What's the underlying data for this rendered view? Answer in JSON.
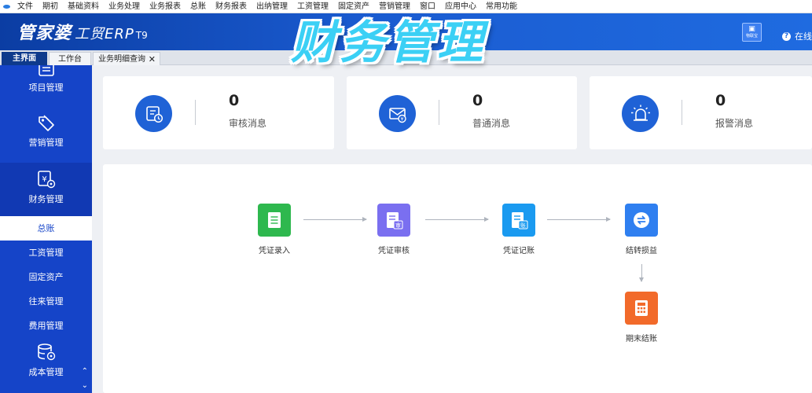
{
  "menubar": {
    "items": [
      "文件",
      "期初",
      "基础资料",
      "业务处理",
      "业务报表",
      "总账",
      "财务报表",
      "出纳管理",
      "工资管理",
      "固定资产",
      "营销管理",
      "窗口",
      "应用中心",
      "常用功能"
    ]
  },
  "header": {
    "logo_main": "管家婆",
    "logo_sub": "工贸ERP",
    "logo_version": "T9",
    "banner_title": "财务管理",
    "iot_label": "物联宝",
    "online_text": "在线"
  },
  "tabs": {
    "main": "主界面",
    "workbench": "工作台",
    "query": "业务明细查询",
    "close_glyph": "✕"
  },
  "sidebar": {
    "modules": {
      "project": "项目管理",
      "marketing": "营销管理",
      "finance": "财务管理",
      "cost": "成本管理"
    },
    "sub_items": {
      "ledger": "总账",
      "salary": "工资管理",
      "assets": "固定资产",
      "dealings": "往来管理",
      "expense": "费用管理"
    },
    "scroll_up": "⌃",
    "scroll_down": "⌄"
  },
  "cards": {
    "audit": {
      "count": "0",
      "label": "审核消息"
    },
    "normal": {
      "count": "0",
      "label": "普通消息"
    },
    "alarm": {
      "count": "0",
      "label": "报警消息"
    }
  },
  "workflow": {
    "voucher_entry": {
      "label": "凭证录入",
      "color": "#2eb84e"
    },
    "voucher_audit": {
      "label": "凭证审核",
      "color": "#7a6ff0",
      "badge": "审"
    },
    "voucher_post": {
      "label": "凭证记账",
      "color": "#1a9af0",
      "badge": "账"
    },
    "carry_forward": {
      "label": "结转损益",
      "color": "#2f7ff0"
    },
    "period_close": {
      "label": "期末结账",
      "color": "#f26a2a"
    }
  },
  "colors": {
    "sidebar_bg": "#1544c8",
    "header_accent": "#1f6be0",
    "card_icon_bg": "#1f62d6"
  }
}
